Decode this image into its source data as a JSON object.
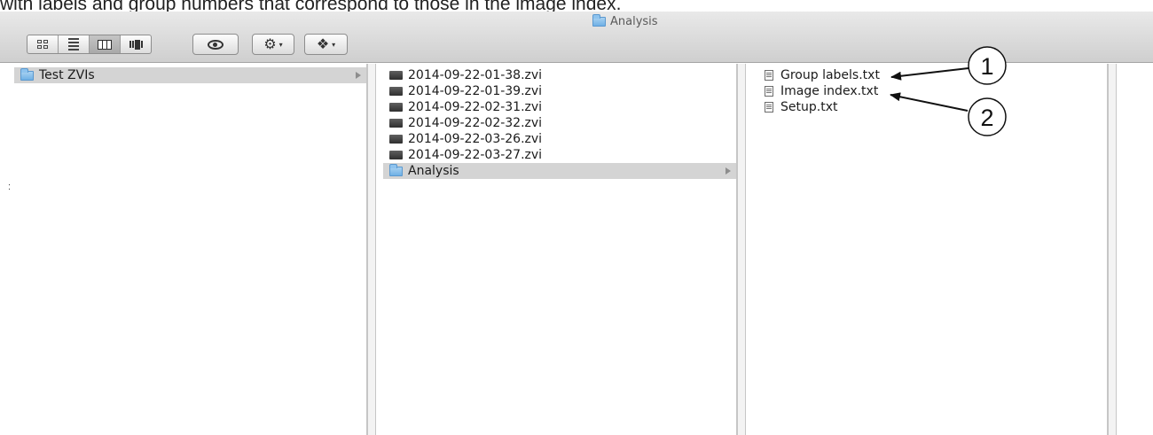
{
  "caption": "with labels and group numbers that correspond to those in the image index.",
  "window": {
    "title": "Analysis"
  },
  "toolbar": {
    "view_buttons": [
      {
        "name": "icon-view",
        "active": false
      },
      {
        "name": "list-view",
        "active": false
      },
      {
        "name": "column-view",
        "active": true
      },
      {
        "name": "cover-flow-view",
        "active": false
      }
    ],
    "quick_look_icon": "eye-icon",
    "action_icon": "gear-icon",
    "dropbox_icon": "dropbox-icon",
    "caret": "▾"
  },
  "columns": [
    {
      "items": [
        {
          "label": "Test ZVIs",
          "icon": "folder-icon",
          "selected": true,
          "has_children": true
        }
      ]
    },
    {
      "items": [
        {
          "label": "2014-09-22-01-38.zvi",
          "icon": "zvi-file-icon",
          "selected": false,
          "has_children": false
        },
        {
          "label": "2014-09-22-01-39.zvi",
          "icon": "zvi-file-icon",
          "selected": false,
          "has_children": false
        },
        {
          "label": "2014-09-22-02-31.zvi",
          "icon": "zvi-file-icon",
          "selected": false,
          "has_children": false
        },
        {
          "label": "2014-09-22-02-32.zvi",
          "icon": "zvi-file-icon",
          "selected": false,
          "has_children": false
        },
        {
          "label": "2014-09-22-03-26.zvi",
          "icon": "zvi-file-icon",
          "selected": false,
          "has_children": false
        },
        {
          "label": "2014-09-22-03-27.zvi",
          "icon": "zvi-file-icon",
          "selected": false,
          "has_children": false
        },
        {
          "label": "Analysis",
          "icon": "folder-icon",
          "selected": true,
          "has_children": true
        }
      ]
    },
    {
      "items": [
        {
          "label": "Group labels.txt",
          "icon": "text-file-icon",
          "selected": false,
          "has_children": false
        },
        {
          "label": "Image index.txt",
          "icon": "text-file-icon",
          "selected": false,
          "has_children": false
        },
        {
          "label": "Setup.txt",
          "icon": "text-file-icon",
          "selected": false,
          "has_children": false
        }
      ]
    }
  ],
  "annotations": [
    {
      "number": "1",
      "points_to": "Group labels.txt"
    },
    {
      "number": "2",
      "points_to": "Image index.txt"
    }
  ]
}
